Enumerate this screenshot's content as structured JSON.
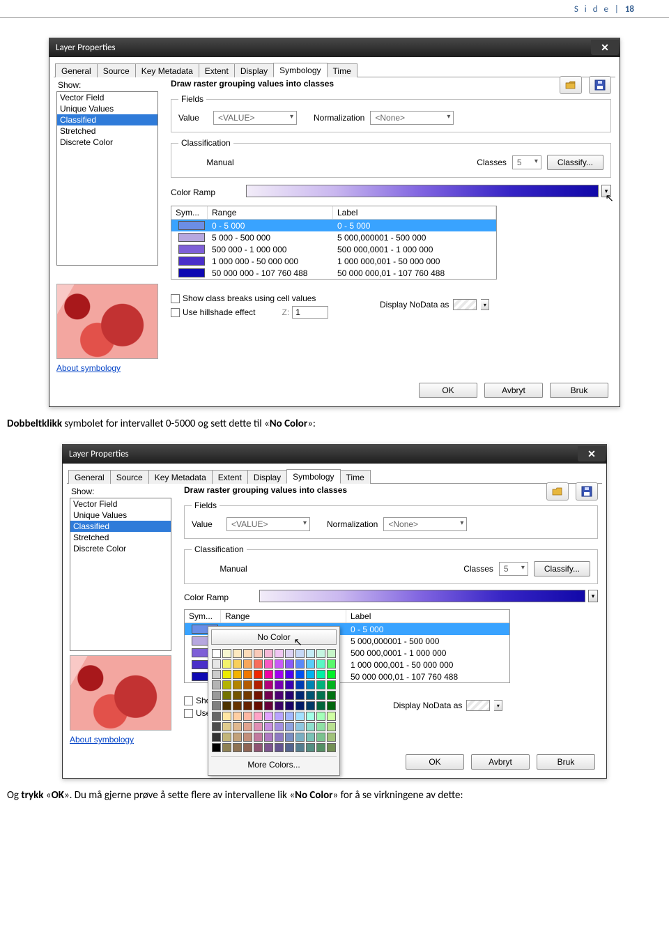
{
  "page_header": {
    "label": "S i d e  |",
    "number": "18"
  },
  "caption1_pre": "Dobbeltklikk",
  "caption1_mid": " symbolet for intervallet 0-5000 og sett dette til «",
  "caption1_bold": "No Color",
  "caption1_post": "»:",
  "caption2_pre": "Og ",
  "caption2_b1": "trykk",
  "caption2_mid1": " «",
  "caption2_b2": "OK",
  "caption2_mid2": "». Du må gjerne prøve å sette flere av intervallene lik «",
  "caption2_b3": "No Color",
  "caption2_post": "» for å se virkningene av dette:",
  "dialog": {
    "title": "Layer Properties",
    "tabs": [
      "General",
      "Source",
      "Key Metadata",
      "Extent",
      "Display",
      "Symbology",
      "Time"
    ],
    "active_tab_index": 5,
    "show_label": "Show:",
    "show_items": [
      "Vector Field",
      "Unique Values",
      "Classified",
      "Stretched",
      "Discrete Color"
    ],
    "show_selected_index": 2,
    "about_link": "About symbology",
    "heading": "Draw raster grouping values into classes",
    "fields_legend": "Fields",
    "value_label": "Value",
    "value_combo": "<VALUE>",
    "norm_label": "Normalization",
    "norm_combo": "<None>",
    "classif_legend": "Classification",
    "classif_method": "Manual",
    "classes_label": "Classes",
    "classes_value": "5",
    "classify_btn": "Classify...",
    "ramp_label": "Color Ramp",
    "table_headers": [
      "Sym...",
      "Range",
      "Label"
    ],
    "rows": [
      {
        "color": "#6b8ee6",
        "range": "0 - 5 000",
        "label": "0 - 5 000"
      },
      {
        "color": "#b7a8df",
        "range": "5 000 - 500 000",
        "label": "5 000,000001 - 500 000"
      },
      {
        "color": "#7e5fd7",
        "range": "500 000 - 1 000 000",
        "label": "500 000,0001 - 1 000 000"
      },
      {
        "color": "#4a2fc9",
        "range": "1 000 000 - 50 000 000",
        "label": "1 000 000,001 - 50 000 000"
      },
      {
        "color": "#0e08b2",
        "range": "50 000 000 - 107 760 488",
        "label": "50 000 000,01 - 107 760 488"
      }
    ],
    "chk1": "Show class breaks using cell values",
    "chk2": "Use hillshade effect",
    "z_label": "Z:",
    "z_value": "1",
    "nodata_label": "Display NoData as",
    "ok": "OK",
    "cancel": "Avbryt",
    "apply": "Bruk"
  },
  "color_popup": {
    "no_color": "No Color",
    "more_colors": "More Colors...",
    "swatches": [
      "#ffffff",
      "#f7f7d0",
      "#fde9c0",
      "#fddcb8",
      "#f8c9b8",
      "#f5b8d6",
      "#f0c6f2",
      "#dcd2f4",
      "#c6d8f6",
      "#c6ecf6",
      "#c6f6e2",
      "#c6f6c8",
      "#e6e6e6",
      "#f3f36b",
      "#f8cf5a",
      "#f8a65a",
      "#f86d5a",
      "#f85ac3",
      "#c85af8",
      "#8a5af8",
      "#5a8af8",
      "#5acdf8",
      "#5af8c3",
      "#5af86b",
      "#cccccc",
      "#ecec00",
      "#f3b200",
      "#f07800",
      "#f02800",
      "#f000a4",
      "#a000f0",
      "#5200f0",
      "#0052f0",
      "#00b2f0",
      "#00f0a4",
      "#00f028",
      "#b3b3b3",
      "#b3b300",
      "#b38400",
      "#b35a00",
      "#b31e00",
      "#b3007b",
      "#7800b3",
      "#3d00b3",
      "#003db3",
      "#0084b3",
      "#00b37b",
      "#00b31e",
      "#999999",
      "#737300",
      "#735500",
      "#733a00",
      "#731300",
      "#73004f",
      "#4d0073",
      "#270073",
      "#002773",
      "#005573",
      "#00734f",
      "#007313",
      "#808080",
      "#4d3300",
      "#663300",
      "#662200",
      "#660d00",
      "#66003a",
      "#3a0066",
      "#1a0066",
      "#001a66",
      "#003a66",
      "#00663a",
      "#00660d",
      "#666666",
      "#ffe6a3",
      "#ffcfa3",
      "#ffb8a3",
      "#ffa3c7",
      "#e0a3ff",
      "#b8a3ff",
      "#a3b8ff",
      "#a3e0ff",
      "#a3ffe6",
      "#a3ffb8",
      "#cfffa3",
      "#4d4d4d",
      "#e0cc8f",
      "#e0b88f",
      "#e0a38f",
      "#e08fb3",
      "#c78fe0",
      "#a38fe0",
      "#8fa3e0",
      "#8fc7e0",
      "#8fe0cc",
      "#8fe0a3",
      "#b8e08f",
      "#333333",
      "#c2b57a",
      "#c2a17a",
      "#c28e7a",
      "#c27a9e",
      "#ae7ac2",
      "#8e7ac2",
      "#7a8ec2",
      "#7aaec2",
      "#7ac2b5",
      "#7ac28e",
      "#a1c27a",
      "#000000",
      "#8f8254",
      "#8f7354",
      "#8f6454",
      "#8f5472",
      "#7d548f",
      "#64548f",
      "#54648f",
      "#547d8f",
      "#548f82",
      "#548f64",
      "#738f54"
    ]
  }
}
